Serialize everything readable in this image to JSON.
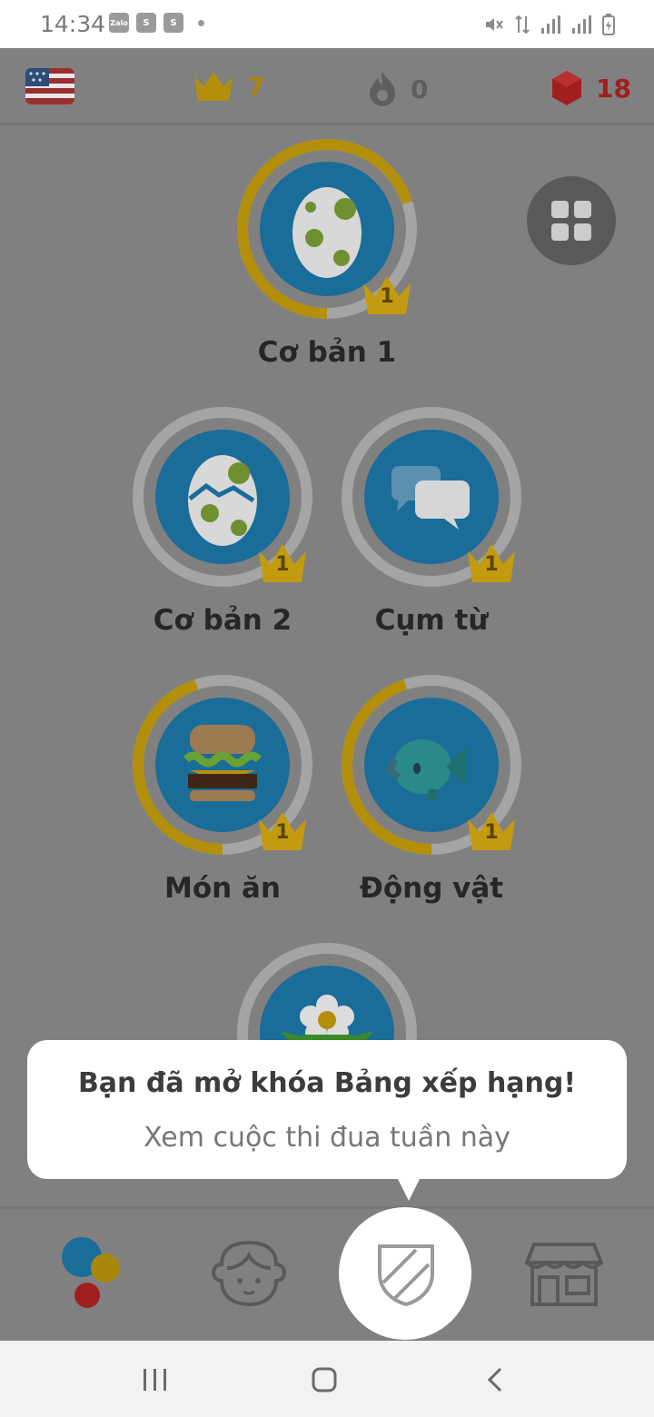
{
  "status_bar": {
    "time": "14:34",
    "apps": [
      "Zalo",
      "S",
      "S"
    ]
  },
  "top_bar": {
    "flag_icon": "us-flag-icon",
    "crowns": "7",
    "streak": "0",
    "gems": "18"
  },
  "skills": [
    {
      "label": "Cơ bản 1",
      "level": "1",
      "icon": "egg-icon",
      "progress": 0.7
    },
    {
      "label": "Cơ bản 2",
      "level": "1",
      "icon": "cracked-egg-icon",
      "progress": 0
    },
    {
      "label": "Cụm từ",
      "level": "1",
      "icon": "speech-bubbles-icon",
      "progress": 0
    },
    {
      "label": "Món ăn",
      "level": "1",
      "icon": "burger-icon",
      "progress": 0.45
    },
    {
      "label": "Động vật",
      "level": "1",
      "icon": "fish-icon",
      "progress": 0.45
    },
    {
      "label": "",
      "level": "",
      "icon": "flower-icon",
      "progress": 0
    }
  ],
  "tooltip": {
    "title": "Bạn đã mở khóa Bảng xếp hạng!",
    "subtitle": "Xem cuộc thi đua tuần này"
  },
  "bottom_nav": [
    "learn-icon",
    "profile-icon",
    "leaderboard-shield-icon",
    "shop-icon"
  ],
  "colors": {
    "overlay": "#808080",
    "ring_gold": "#b38f0c",
    "ring_gray": "#a5a5a5",
    "skill_blue": "#1a6c99",
    "crown_gold": "#c39b10",
    "gem_red": "#a21e1e"
  }
}
